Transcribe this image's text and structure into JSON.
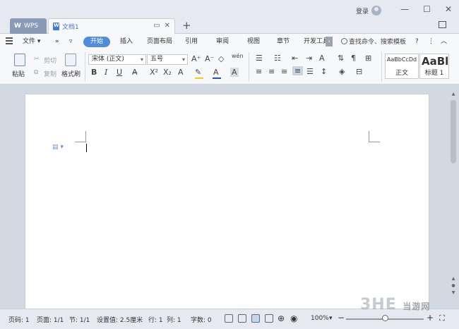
{
  "titlebar": {
    "tabs": [
      {
        "label": "WPS"
      },
      {
        "label": "文档1"
      }
    ],
    "login_label": "登录",
    "new_tab": "+"
  },
  "ribbon": {
    "file_label": "文件",
    "tabs": [
      "开始",
      "插入",
      "页面布局",
      "引用",
      "审阅",
      "视图",
      "章节",
      "开发工具"
    ],
    "active_tab": "开始",
    "search_label": "查找命令、搜索模板",
    "help": "?"
  },
  "toolbar": {
    "paste_label": "粘贴",
    "cut_label": "剪切",
    "copy_label": "复制",
    "format_painter_label": "格式刷",
    "font_name": "宋体 (正文)",
    "font_size": "五号",
    "bold": "B",
    "italic": "I",
    "underline": "U",
    "styles": [
      {
        "sample": "AaBbCcDd",
        "name": "正文"
      },
      {
        "sample": "AaBl",
        "name": "标题 1"
      }
    ],
    "accent": "#4f8ddb",
    "highlight_color": "#f5d000",
    "font_color": "#1f4fd8"
  },
  "statusbar": {
    "page": "页码: 1",
    "pages": "页面: 1/1",
    "section": "节: 1/1",
    "setting": "设置值: 2.5厘米",
    "row": "行: 1",
    "col": "列: 1",
    "word_count": "字数: 0",
    "zoom": "100%",
    "zoom_minus": "−",
    "zoom_plus": "+"
  },
  "watermark": {
    "brand": "3HE",
    "site": "当游网"
  }
}
